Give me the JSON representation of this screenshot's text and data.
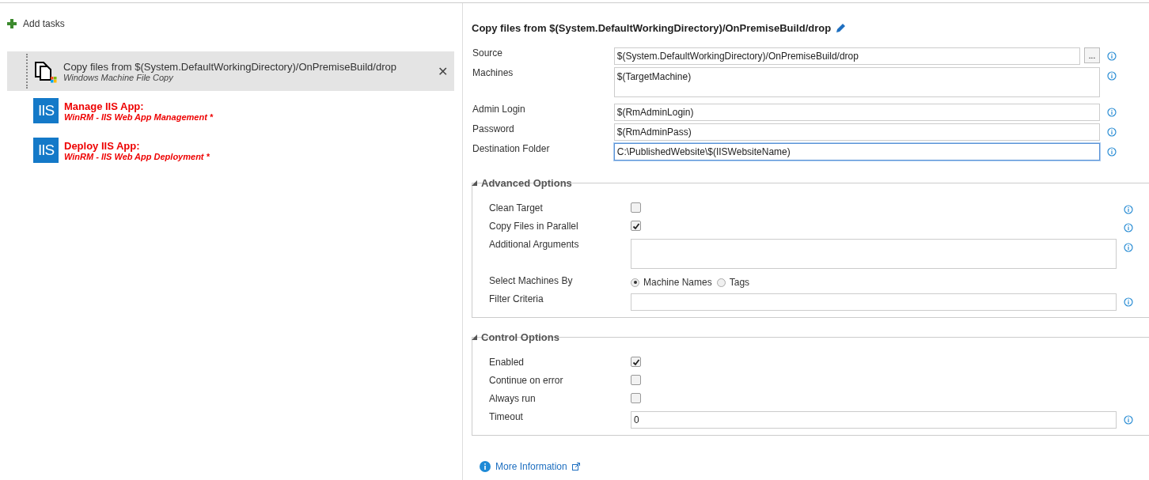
{
  "add_tasks": {
    "label": "Add tasks"
  },
  "tasks": [
    {
      "title": "Copy files from $(System.DefaultWorkingDirectory)/OnPremiseBuild/drop",
      "subtitle": "Windows Machine File Copy",
      "kind": "copy",
      "selected": true,
      "invalid": false,
      "remove": "✕"
    },
    {
      "title": "Manage IIS App:",
      "subtitle": "WinRM - IIS Web App Management *",
      "kind": "iis",
      "selected": false,
      "invalid": true,
      "icon_text": "IIS"
    },
    {
      "title": "Deploy IIS App:",
      "subtitle": "WinRM - IIS Web App Deployment *",
      "kind": "iis",
      "selected": false,
      "invalid": true,
      "icon_text": "IIS"
    }
  ],
  "detail": {
    "title": "Copy files from $(System.DefaultWorkingDirectory)/OnPremiseBuild/drop",
    "fields": [
      {
        "label": "Source",
        "kind": "browse",
        "value": "$(System.DefaultWorkingDirectory)/OnPremiseBuild/drop",
        "button": "...",
        "focused": false
      },
      {
        "label": "Machines",
        "kind": "textarea",
        "value": "$(TargetMachine)",
        "focused": false
      },
      {
        "label": "Admin Login",
        "kind": "text",
        "value": "$(RmAdminLogin)",
        "focused": false
      },
      {
        "label": "Password",
        "kind": "text",
        "value": "$(RmAdminPass)",
        "focused": false
      },
      {
        "label": "Destination Folder",
        "kind": "text",
        "value": "C:\\PublishedWebsite\\$(IISWebsiteName)",
        "focused": true
      }
    ],
    "sections": [
      {
        "title": "Advanced Options",
        "expanded": true,
        "rows": [
          {
            "label": "Clean Target",
            "kind": "checkbox",
            "checked": false,
            "info": true
          },
          {
            "label": "Copy Files in Parallel",
            "kind": "checkbox",
            "checked": true,
            "info": true
          },
          {
            "label": "Additional Arguments",
            "kind": "textarea",
            "value": "",
            "info": true
          },
          {
            "label": "Select Machines By",
            "kind": "radio",
            "options": [
              {
                "label": "Machine Names",
                "selected": true
              },
              {
                "label": "Tags",
                "selected": false
              }
            ],
            "info": false
          },
          {
            "label": "Filter Criteria",
            "kind": "text",
            "value": "",
            "info": true
          }
        ]
      },
      {
        "title": "Control Options",
        "expanded": true,
        "rows": [
          {
            "label": "Enabled",
            "kind": "checkbox",
            "checked": true,
            "info": false
          },
          {
            "label": "Continue on error",
            "kind": "checkbox",
            "checked": false,
            "info": false
          },
          {
            "label": "Always run",
            "kind": "checkbox",
            "checked": false,
            "info": false
          },
          {
            "label": "Timeout",
            "kind": "text",
            "value": "0",
            "info": true
          }
        ]
      }
    ],
    "more_info": "More Information"
  }
}
